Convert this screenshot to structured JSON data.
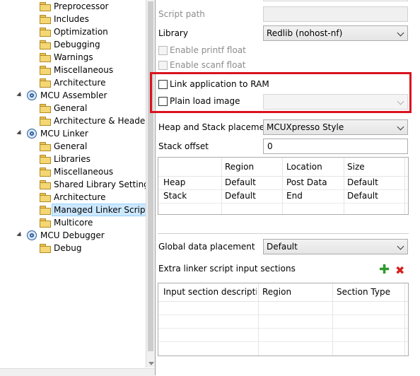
{
  "tree": {
    "items": [
      {
        "label": "Preprocessor",
        "icon": "folder-icon",
        "level": 2
      },
      {
        "label": "Includes",
        "icon": "folder-icon",
        "level": 2
      },
      {
        "label": "Optimization",
        "icon": "folder-icon",
        "level": 2
      },
      {
        "label": "Debugging",
        "icon": "folder-icon",
        "level": 2
      },
      {
        "label": "Warnings",
        "icon": "folder-icon",
        "level": 2
      },
      {
        "label": "Miscellaneous",
        "icon": "folder-icon",
        "level": 2
      },
      {
        "label": "Architecture",
        "icon": "folder-icon",
        "level": 2
      },
      {
        "label": "MCU Assembler",
        "icon": "gear-icon",
        "level": 1
      },
      {
        "label": "General",
        "icon": "folder-icon",
        "level": 2
      },
      {
        "label": "Architecture & Headers",
        "icon": "folder-icon",
        "level": 2
      },
      {
        "label": "MCU Linker",
        "icon": "gear-icon",
        "level": 1
      },
      {
        "label": "General",
        "icon": "folder-icon",
        "level": 2
      },
      {
        "label": "Libraries",
        "icon": "folder-icon",
        "level": 2
      },
      {
        "label": "Miscellaneous",
        "icon": "folder-icon",
        "level": 2
      },
      {
        "label": "Shared Library Settings",
        "icon": "folder-icon",
        "level": 2
      },
      {
        "label": "Architecture",
        "icon": "folder-icon",
        "level": 2
      },
      {
        "label": "Managed Linker Script",
        "icon": "folder-icon",
        "level": 2,
        "selected": true
      },
      {
        "label": "Multicore",
        "icon": "folder-icon",
        "level": 2
      },
      {
        "label": "MCU Debugger",
        "icon": "gear-icon",
        "level": 1
      },
      {
        "label": "Debug",
        "icon": "folder-icon",
        "level": 2
      }
    ]
  },
  "settings": {
    "script_path_label": "Script path",
    "library_label": "Library",
    "library_value": "Redlib (nohost-nf)",
    "enable_printf_float_label": "Enable printf float",
    "enable_scanf_float_label": "Enable scanf float",
    "link_to_ram_label": "Link application to RAM",
    "plain_load_image_label": "Plain load image",
    "heap_stack_placement_label": "Heap and Stack placement",
    "heap_stack_placement_value": "MCUXpresso Style",
    "stack_offset_label": "Stack offset",
    "stack_offset_value": "0",
    "global_data_placement_label": "Global data placement",
    "global_data_placement_value": "Default",
    "extra_sections_label": "Extra linker script input sections"
  },
  "heap_table": {
    "headers": [
      "",
      "Region",
      "Location",
      "Size"
    ],
    "rows": [
      [
        "Heap",
        "Default",
        "Post Data",
        "Default"
      ],
      [
        "Stack",
        "Default",
        "End",
        "Default"
      ]
    ]
  },
  "sections_table": {
    "headers": [
      "Input section descripti...",
      "Region",
      "Section Type"
    ]
  },
  "colors": {
    "highlight": "#d9131e",
    "selection": "#cce8ff",
    "add_icon": "#2e9a2e",
    "remove_icon": "#d6201f"
  }
}
